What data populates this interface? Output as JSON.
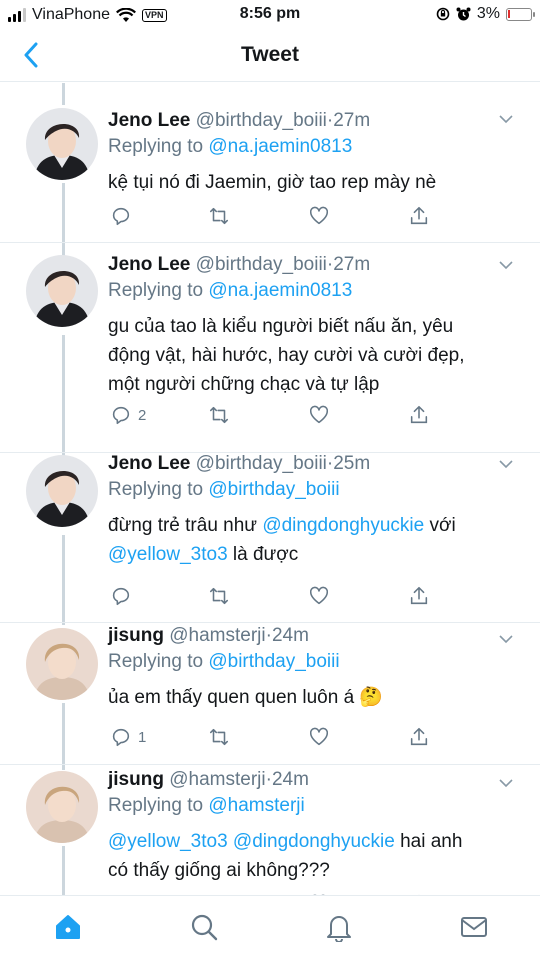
{
  "status_bar": {
    "carrier": "VinaPhone",
    "vpn": "VPN",
    "time": "8:56 pm",
    "battery": "3%"
  },
  "nav": {
    "title": "Tweet"
  },
  "colors": {
    "link": "#1da1f2",
    "secondary": "#657786",
    "active_tab": "#1da1f2"
  },
  "tweets": [
    {
      "name": "Jeno Lee",
      "handle": "@birthday_boiii",
      "time": "27m",
      "reply_prefix": "Replying to",
      "reply_to": "@na.jaemin0813",
      "text": "kệ tụi nó đi Jaemin, giờ tao rep mày nè",
      "reply_count": ""
    },
    {
      "name": "Jeno Lee",
      "handle": "@birthday_boiii",
      "time": "27m",
      "reply_prefix": "Replying to",
      "reply_to": "@na.jaemin0813",
      "text_lines": [
        "gu của tao là kiểu người biết nấu ăn, yêu",
        "động vật, hài hước, hay cười và cười đẹp,",
        "một người chững  chạc và tự lập"
      ],
      "reply_count": "2"
    },
    {
      "name": "Jeno Lee",
      "handle": "@birthday_boiii",
      "time": "25m",
      "reply_prefix": "Replying to",
      "reply_to": "@birthday_boiii",
      "text_part1": "đừng trẻ trâu như ",
      "mention1": "@dingdonghyuckie",
      "text_part2": " với",
      "mention2": "@yellow_3to3",
      "text_part3": " là được",
      "reply_count": ""
    },
    {
      "name": "jisung",
      "handle": "@hamsterji",
      "time": "24m",
      "reply_prefix": "Replying to",
      "reply_to": "@birthday_boiii",
      "text": "ủa em thấy quen quen luôn á 🤔",
      "reply_count": "1"
    },
    {
      "name": "jisung",
      "handle": "@hamsterji",
      "time": "24m",
      "reply_prefix": "Replying to",
      "reply_to": "@hamsterji",
      "mention1": "@yellow_3to3",
      "mention2": "@dingdonghyuckie",
      "text_part1": " hai anh",
      "text_line2": "có thấy giống ai không???"
    }
  ],
  "tabs": [
    {
      "name": "home-icon"
    },
    {
      "name": "search-icon"
    },
    {
      "name": "bell-icon"
    },
    {
      "name": "mail-icon"
    }
  ]
}
